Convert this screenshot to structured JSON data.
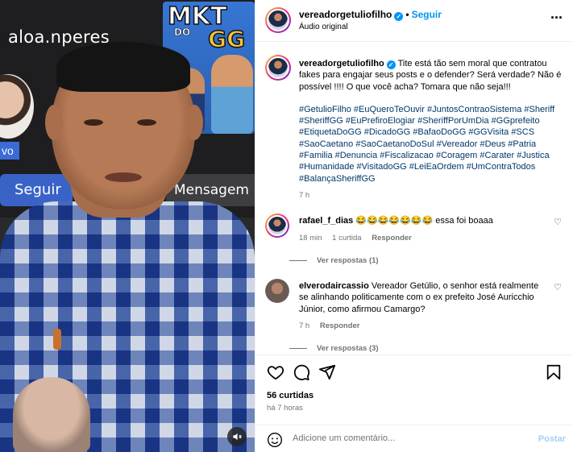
{
  "media": {
    "overlay_name": "aloa.nperes",
    "overlay_follow": "Seguir",
    "overlay_message": "Mensagem",
    "overlay_badge": "vo",
    "cartoon_title": "MKT",
    "cartoon_sub_small": "DO",
    "cartoon_sub": "GG",
    "mute_icon": "muted-speaker-icon"
  },
  "header": {
    "username": "vereadorgetuliofilho",
    "follow_label": "Seguir",
    "subtitle": "Áudio original",
    "more_icon": "more-horizontal-icon"
  },
  "caption": {
    "username": "vereadorgetuliofilho",
    "text": "Tite está tão sem moral que contratou fakes para engajar seus posts e o defender? Será verdade? Não é possível !!!! O que você acha? Tomara que não seja!!!",
    "hashtags": "#GetulioFilho #EuQueroTeOuvir #JuntosContraoSistema #Sheriff #SheriffGG #EuPrefiroElogiar #SheriffPorUmDia #GGprefeito #EtiquetaDoGG #DicadoGG #BafaoDoGG #GGVisita #SCS #SaoCaetano #SaoCaetanoDoSul #Vereador #Deus #Patria #Familia #Denuncia #Fiscalizacao #Coragem #Carater #Justica #Humanidade #VisitadoGG #LeiEaOrdem #UmContraTodos #BalançaSheriffGG",
    "time": "7 h"
  },
  "comments": [
    {
      "username": "rafael_f_dias",
      "text": "😂😂😂😂😂😂😂 essa foi boaaa",
      "time": "18 min",
      "likes": "1 curtida",
      "reply_label": "Responder",
      "view_replies": "Ver respostas (1)"
    },
    {
      "username": "elverodaircassio",
      "text": "Vereador Getúlio, o senhor está realmente se alinhando politicamente com o ex prefeito José Auricchio Júnior, como afirmou Camargo?",
      "time": "7 h",
      "reply_label": "Responder",
      "view_replies": "Ver respostas (3)"
    }
  ],
  "actions": {
    "like_icon": "heart-icon",
    "comment_icon": "comment-icon",
    "share_icon": "share-icon",
    "save_icon": "bookmark-icon"
  },
  "stats": {
    "likes": "56 curtidas",
    "when": "há 7 horas"
  },
  "add_comment": {
    "placeholder": "Adicione um comentário...",
    "post_label": "Postar",
    "emoji_icon": "emoji-icon"
  },
  "colors": {
    "accent": "#0095f6",
    "hashtag": "#00376b",
    "muted": "#737373"
  }
}
